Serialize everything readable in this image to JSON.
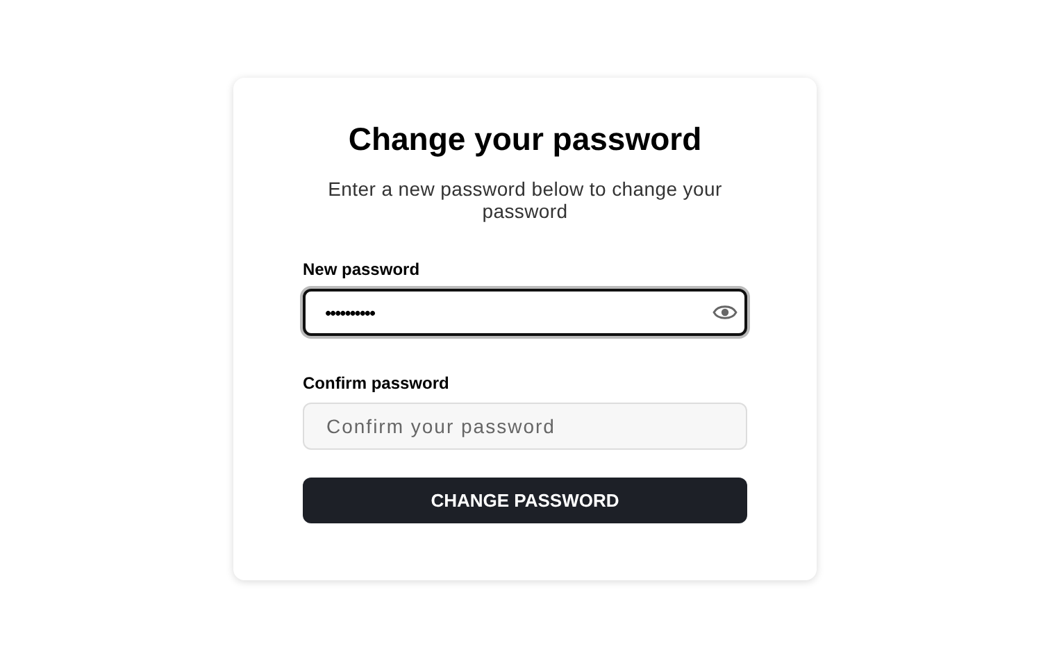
{
  "title": "Change your password",
  "subtitle": "Enter a new password below to change your password",
  "fields": [
    {
      "label": "New password",
      "value": "••••••••••",
      "focused": true,
      "reveal_toggle": true
    },
    {
      "label": "Confirm password",
      "placeholder": "Confirm your password",
      "focused": false,
      "reveal_toggle": false
    }
  ],
  "submit": {
    "label": "CHANGE PASSWORD"
  }
}
